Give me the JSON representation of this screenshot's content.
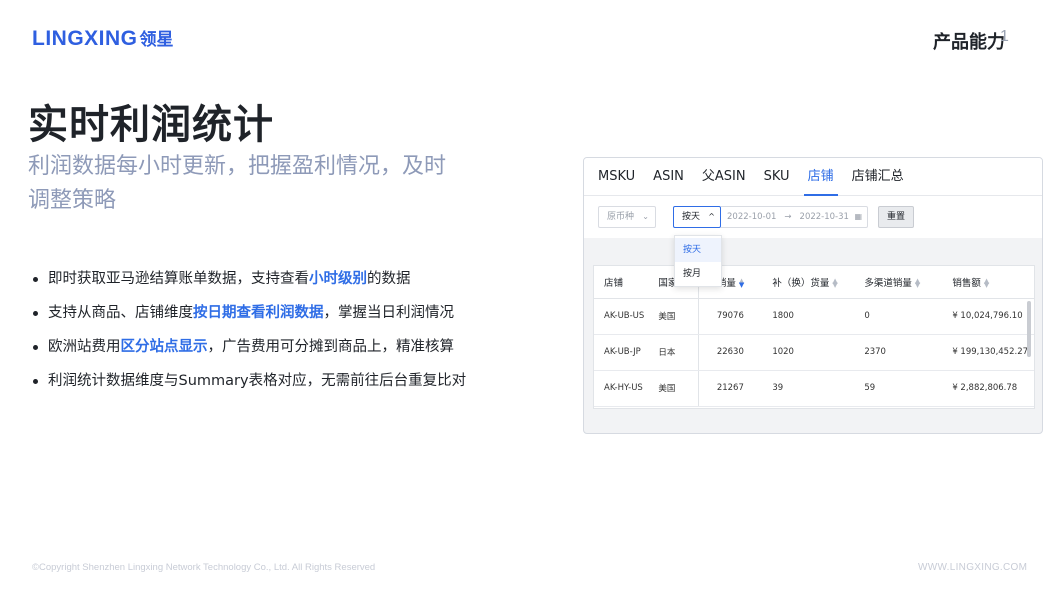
{
  "header": {
    "logo_en": "LINGXING",
    "logo_cn": "领星",
    "section_title": "产品能力",
    "page_number": "1"
  },
  "main": {
    "title": "实时利润统计",
    "subtitle_line1": "利润数据每小时更新，把握盈利情况，及时",
    "subtitle_line2": "调整策略",
    "bullets": [
      {
        "before": "即时获取亚马逊结算账单数据，支持查看",
        "highlight": "小时级别",
        "after": "的数据"
      },
      {
        "before": "支持从商品、店铺维度",
        "highlight": "按日期查看利润数据",
        "after": "，掌握当日利润情况"
      },
      {
        "before": "欧洲站费用",
        "highlight": "区分站点显示",
        "after": "，广告费用可分摊到商品上，精准核算"
      },
      {
        "before": "利润统计数据维度与Summary表格对应，无需前往后台重复比对",
        "highlight": "",
        "after": ""
      }
    ]
  },
  "panel": {
    "tabs": [
      "MSKU",
      "ASIN",
      "父ASIN",
      "SKU",
      "店铺",
      "店铺汇总"
    ],
    "active_tab": "店铺",
    "currency_placeholder": "原币种",
    "period_value": "按天",
    "date_start": "2022-10-01",
    "date_end": "2022-10-31",
    "reset_label": "重置",
    "dropdown_options": [
      "按天",
      "按月"
    ],
    "columns": [
      "店铺",
      "国家",
      "销量",
      "补（换）货量",
      "多渠道销量",
      "销售额"
    ],
    "rows": [
      [
        "AK-UB-US",
        "美国",
        "79076",
        "1800",
        "0",
        "¥ 10,024,796.10"
      ],
      [
        "AK-UB-JP",
        "日本",
        "22630",
        "1020",
        "2370",
        "¥ 199,130,452.27"
      ],
      [
        "AK-HY-US",
        "美国",
        "21267",
        "39",
        "59",
        "¥ 2,882,806.78"
      ]
    ]
  },
  "footer": {
    "copyright": "©Copyright Shenzhen Lingxing Network Technology Co., Ltd. All Rights Reserved",
    "website": "WWW.LINGXING.COM"
  },
  "colors": {
    "brand": "#2f5fe0",
    "highlight": "#2f6de6",
    "subtitle": "#8e9ab8"
  }
}
